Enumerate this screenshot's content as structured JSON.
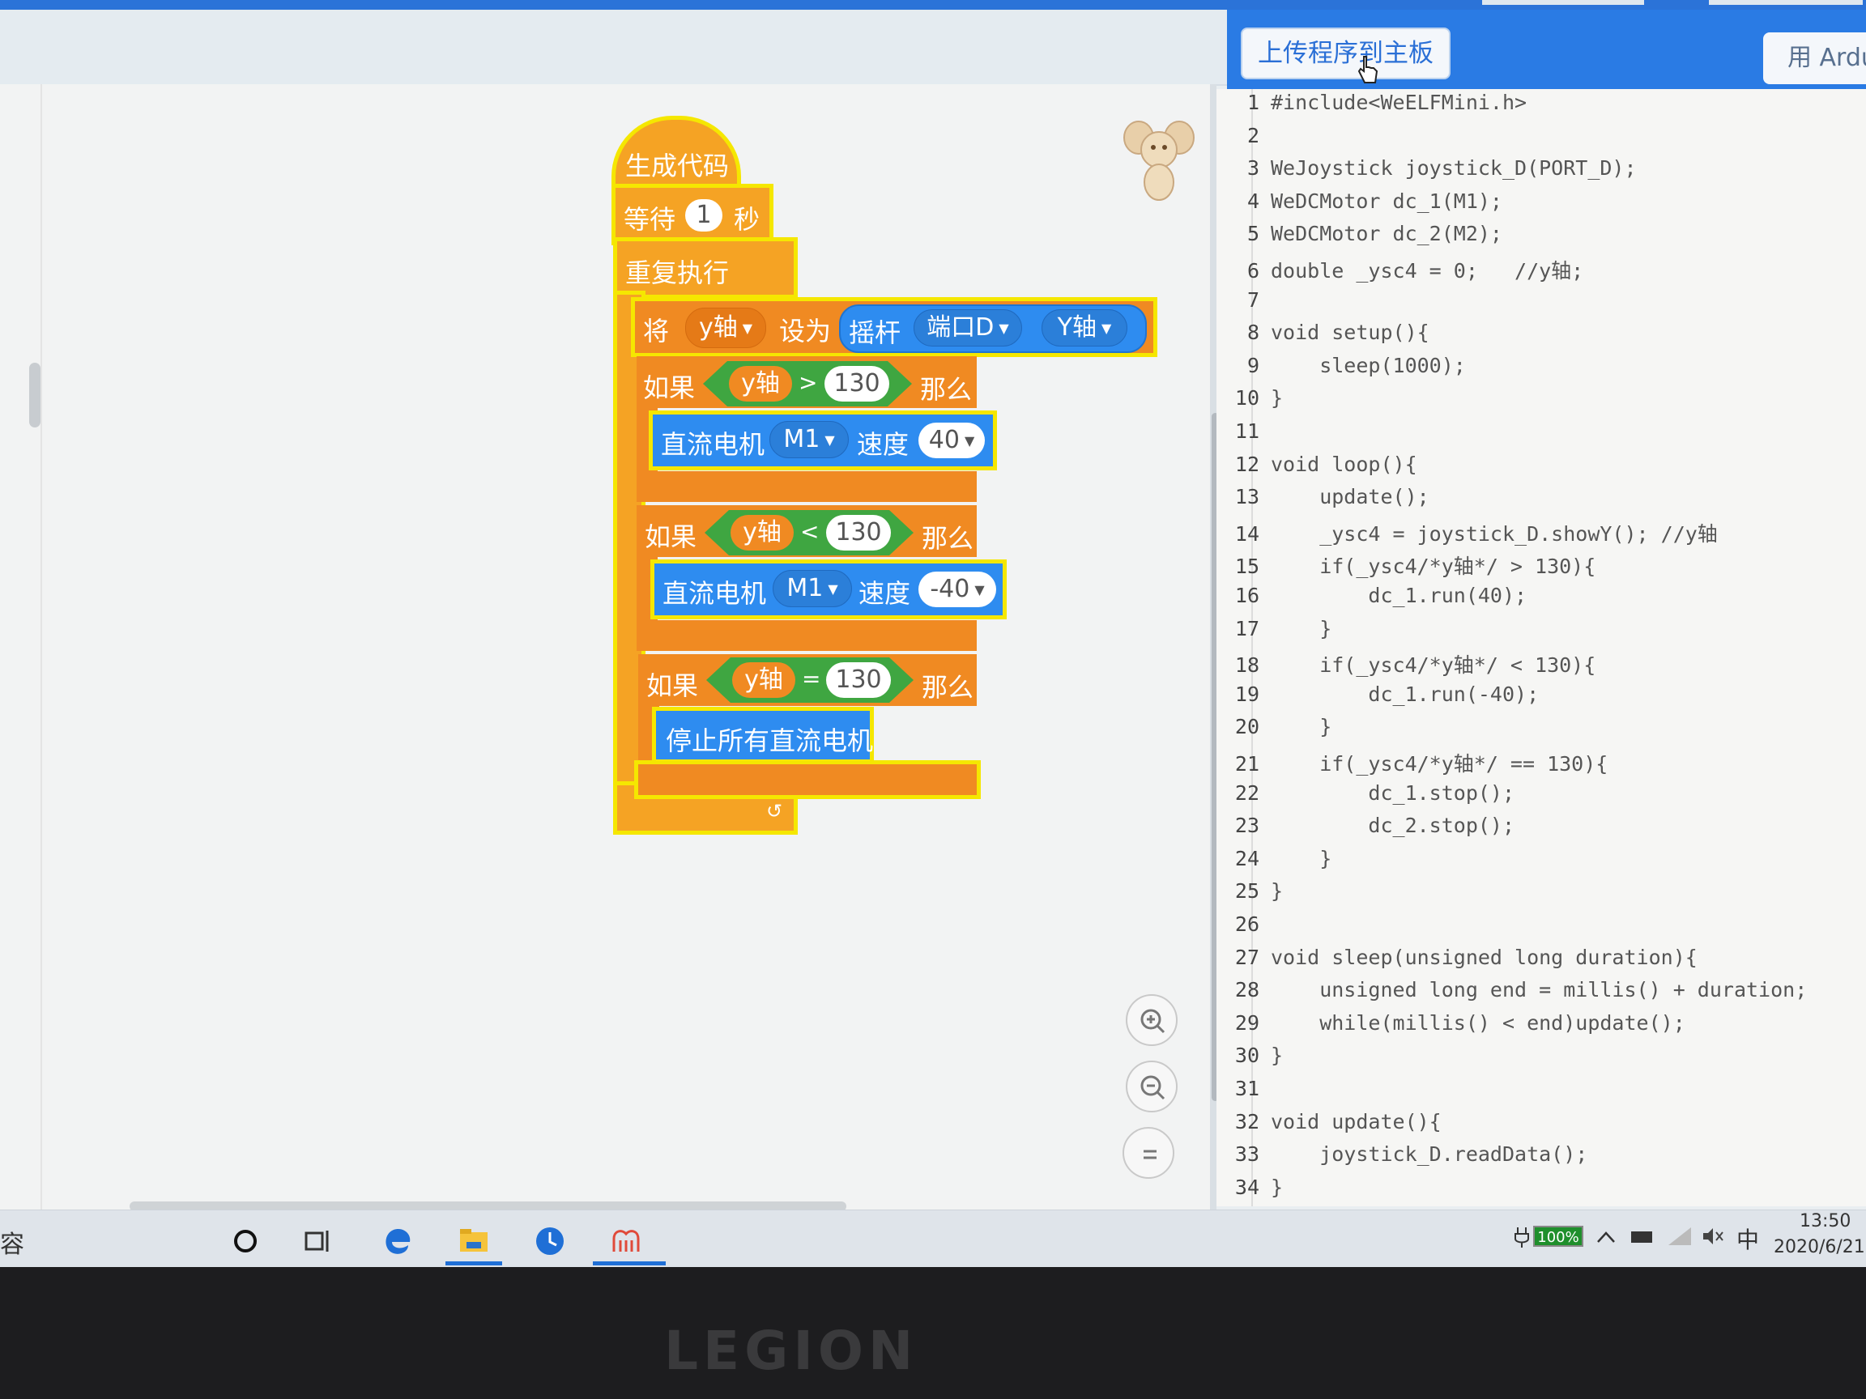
{
  "toolbar": {
    "upload_button": "上传程序到主板",
    "arduino_button": "用 Ardu"
  },
  "blocks": {
    "hat": "生成代码",
    "wait_label": "等待",
    "wait_value": "1",
    "wait_unit": "秒",
    "forever": "重复执行",
    "set_label": "将",
    "set_var": "y轴",
    "set_to": "设为",
    "joystick": "摇杆",
    "port": "端口D",
    "axis": "Y轴",
    "if_label": "如果",
    "then_label": "那么",
    "var": "y轴",
    "cond1_op": ">",
    "cond1_value": "130",
    "cond2_op": "<",
    "cond2_value": "130",
    "cond3_op": "=",
    "cond3_value": "130",
    "motor_label": "直流电机",
    "motor_port": "M1",
    "speed_label": "速度",
    "speed1": "40",
    "speed2": "-40",
    "stop_all": "停止所有直流电机"
  },
  "code_lines": [
    {
      "n": "1",
      "text": "#include<WeELFMini.h>"
    },
    {
      "n": "2",
      "text": ""
    },
    {
      "n": "3",
      "text": "WeJoystick joystick_D(PORT_D);"
    },
    {
      "n": "4",
      "text": "WeDCMotor dc_1(M1);"
    },
    {
      "n": "5",
      "text": "WeDCMotor dc_2(M2);"
    },
    {
      "n": "6",
      "text": "double _ysc4 = 0;   //y轴;"
    },
    {
      "n": "7",
      "text": ""
    },
    {
      "n": "8",
      "text": "void setup(){"
    },
    {
      "n": "9",
      "text": "    sleep(1000);"
    },
    {
      "n": "10",
      "text": "}"
    },
    {
      "n": "11",
      "text": ""
    },
    {
      "n": "12",
      "text": "void loop(){"
    },
    {
      "n": "13",
      "text": "    update();"
    },
    {
      "n": "14",
      "text": "    _ysc4 = joystick_D.showY(); //y轴"
    },
    {
      "n": "15",
      "text": "    if(_ysc4/*y轴*/ > 130){"
    },
    {
      "n": "16",
      "text": "        dc_1.run(40);"
    },
    {
      "n": "17",
      "text": "    }"
    },
    {
      "n": "18",
      "text": "    if(_ysc4/*y轴*/ < 130){"
    },
    {
      "n": "19",
      "text": "        dc_1.run(-40);"
    },
    {
      "n": "20",
      "text": "    }"
    },
    {
      "n": "21",
      "text": "    if(_ysc4/*y轴*/ == 130){"
    },
    {
      "n": "22",
      "text": "        dc_1.stop();"
    },
    {
      "n": "23",
      "text": "        dc_2.stop();"
    },
    {
      "n": "24",
      "text": "    }"
    },
    {
      "n": "25",
      "text": "}"
    },
    {
      "n": "26",
      "text": ""
    },
    {
      "n": "27",
      "text": "void sleep(unsigned long duration){"
    },
    {
      "n": "28",
      "text": "    unsigned long end = millis() + duration;"
    },
    {
      "n": "29",
      "text": "    while(millis() < end)update();"
    },
    {
      "n": "30",
      "text": "}"
    },
    {
      "n": "31",
      "text": ""
    },
    {
      "n": "32",
      "text": "void update(){"
    },
    {
      "n": "33",
      "text": "    joystick_D.readData();"
    },
    {
      "n": "34",
      "text": "}"
    }
  ],
  "taskbar": {
    "left_text": "容",
    "battery": "100%",
    "ime": "中",
    "time": "13:50",
    "date": "2020/6/21"
  },
  "bezel": {
    "brand": "LEGION"
  }
}
